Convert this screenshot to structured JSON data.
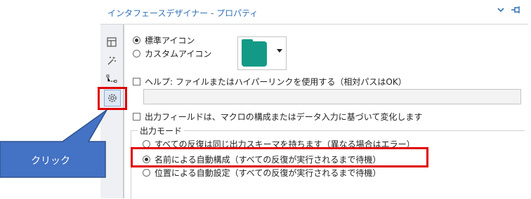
{
  "header": {
    "title": "インタフェースデザイナー - プロパティ",
    "chevron_icon": "chevron-down-icon",
    "pin_icon": "pin-icon"
  },
  "sidebar": {
    "items": [
      {
        "name": "layout-icon"
      },
      {
        "name": "wand-icon"
      },
      {
        "name": "tree-icon"
      },
      {
        "name": "gear-icon",
        "active": true
      }
    ]
  },
  "icon_options": {
    "standard": "標準アイコン",
    "custom": "カスタムアイコン",
    "selected": "standard"
  },
  "help": {
    "checkbox_label": "ヘルプ: ファイルまたはハイパーリンクを使用する（相対パスはOK）",
    "value": ""
  },
  "output_fields": {
    "checkbox_label": "出力フィールドは、マクロの構成またはデータ入力に基づいて変化します"
  },
  "output_mode": {
    "label": "出力モード",
    "options": [
      "すべての反復は同じ出力スキーマを持ちます（異なる場合はエラー）",
      "名前による自動構成（すべての反復が実行されるまで待機）",
      "位置による自動設定（すべての反復が実行されるまで待機）"
    ],
    "selected_index": 1
  },
  "annotation": {
    "callout_text": "クリック"
  },
  "colors": {
    "accent": "#2f6fb5",
    "highlight": "#e00000",
    "callout": "#4472c4",
    "folder": "#139a87"
  }
}
